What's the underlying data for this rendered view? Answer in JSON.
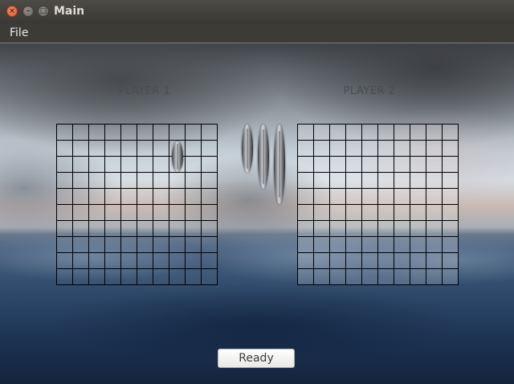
{
  "window": {
    "title": "Main"
  },
  "menubar": {
    "items": [
      {
        "label": "File"
      }
    ]
  },
  "game": {
    "player1": {
      "label": "PLAYER 1"
    },
    "player2": {
      "label": "PLAYER 2"
    },
    "grid_size": 10
  },
  "ready_button": {
    "label": "Ready"
  }
}
